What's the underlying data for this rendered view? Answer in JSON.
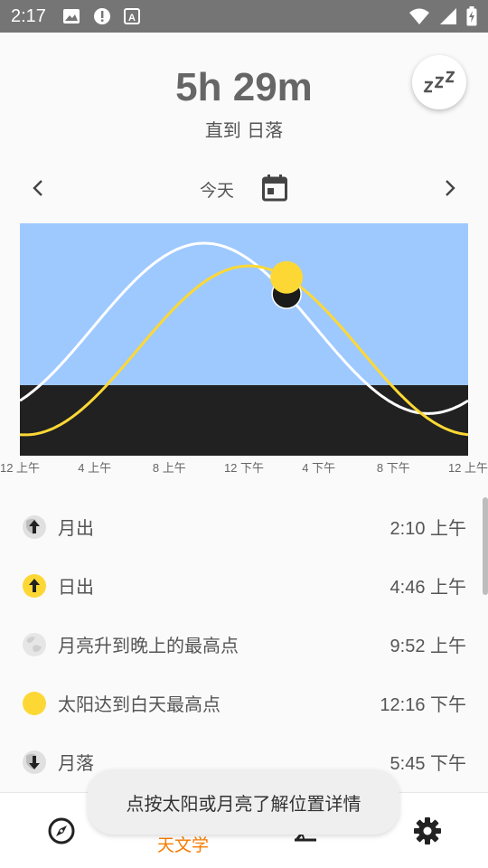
{
  "status_bar": {
    "time": "2:17",
    "left_icons": [
      "image-icon",
      "alert-icon",
      "font-icon"
    ],
    "right_icons": [
      "wifi-icon",
      "signal-icon",
      "battery-charging-icon"
    ]
  },
  "header": {
    "countdown": "5h 29m",
    "countdown_caption": "直到 日落",
    "sleep_button_icon": "zzz-icon"
  },
  "date_nav": {
    "date_label": "今天",
    "prev_icon": "chevron-left-icon",
    "next_icon": "chevron-right-icon",
    "calendar_icon": "calendar-icon"
  },
  "chart_data": {
    "type": "line",
    "x_tick_labels": [
      "12 上午",
      "4 上午",
      "8 上午",
      "12 下午",
      "4 下午",
      "8 下午",
      "12 上午"
    ],
    "series": [
      {
        "key": "moon",
        "color": "#ffffff",
        "peak_hour": 9.87,
        "min_altitude": -0.2,
        "max_altitude": 1.0
      },
      {
        "key": "sun",
        "color": "#fdd835",
        "peak_hour": 12.27,
        "min_altitude": -0.35,
        "max_altitude": 0.84
      }
    ],
    "current_hour": 14.28,
    "colors": {
      "sky": "#9ec9ff",
      "ground": "#212121",
      "sun": "#fdd835",
      "moon": "#1b1b1b"
    }
  },
  "events": [
    {
      "name": "月出",
      "time": "2:10 上午",
      "icon": "moonrise-icon"
    },
    {
      "name": "日出",
      "time": "4:46 上午",
      "icon": "sunrise-icon"
    },
    {
      "name": "月亮升到晚上的最高点",
      "time": "9:52 上午",
      "icon": "moon-phase-icon"
    },
    {
      "name": "太阳达到白天最高点",
      "time": "12:16 下午",
      "icon": "sun-icon"
    },
    {
      "name": "月落",
      "time": "5:45 下午",
      "icon": "moonset-icon"
    }
  ],
  "bottom_nav": {
    "items": [
      {
        "icon": "compass-icon",
        "label": ""
      },
      {
        "icon": "astronomy-icon",
        "label": "天文学"
      },
      {
        "icon": "inclinometer-icon",
        "label": ""
      },
      {
        "icon": "settings-icon",
        "label": ""
      }
    ],
    "active_color": "#f57c00"
  },
  "toast": {
    "message": "点按太阳或月亮了解位置详情"
  }
}
